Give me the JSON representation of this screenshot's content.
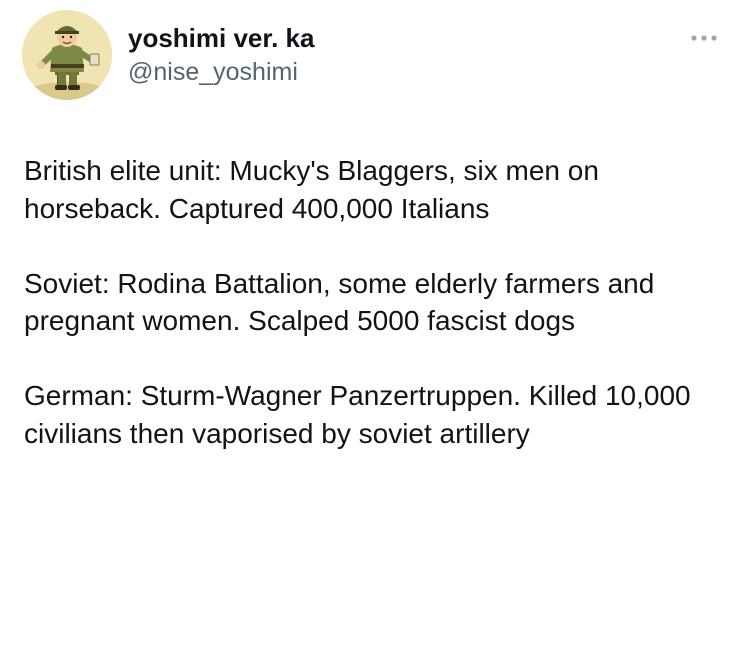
{
  "author": {
    "display_name": "yoshimi ver. ka",
    "handle": "@nise_yoshimi",
    "avatar_icon": "cartoon-soldier-avatar"
  },
  "menu": {
    "icon": "more-horizontal-icon"
  },
  "tweet": {
    "paragraphs": [
      "British elite unit: Mucky's Blaggers, six men on horseback. Captured 400,000 Italians",
      "Soviet: Rodina Battalion, some elderly farmers and pregnant women. Scalped 5000 fascist dogs",
      "German: Sturm-Wagner Panzertruppen. Killed 10,000 civilians then vaporised by soviet artillery"
    ]
  },
  "colors": {
    "text": "#0f1419",
    "secondary": "#536471",
    "background": "#ffffff",
    "avatar_bg": "#f1e7b8"
  }
}
